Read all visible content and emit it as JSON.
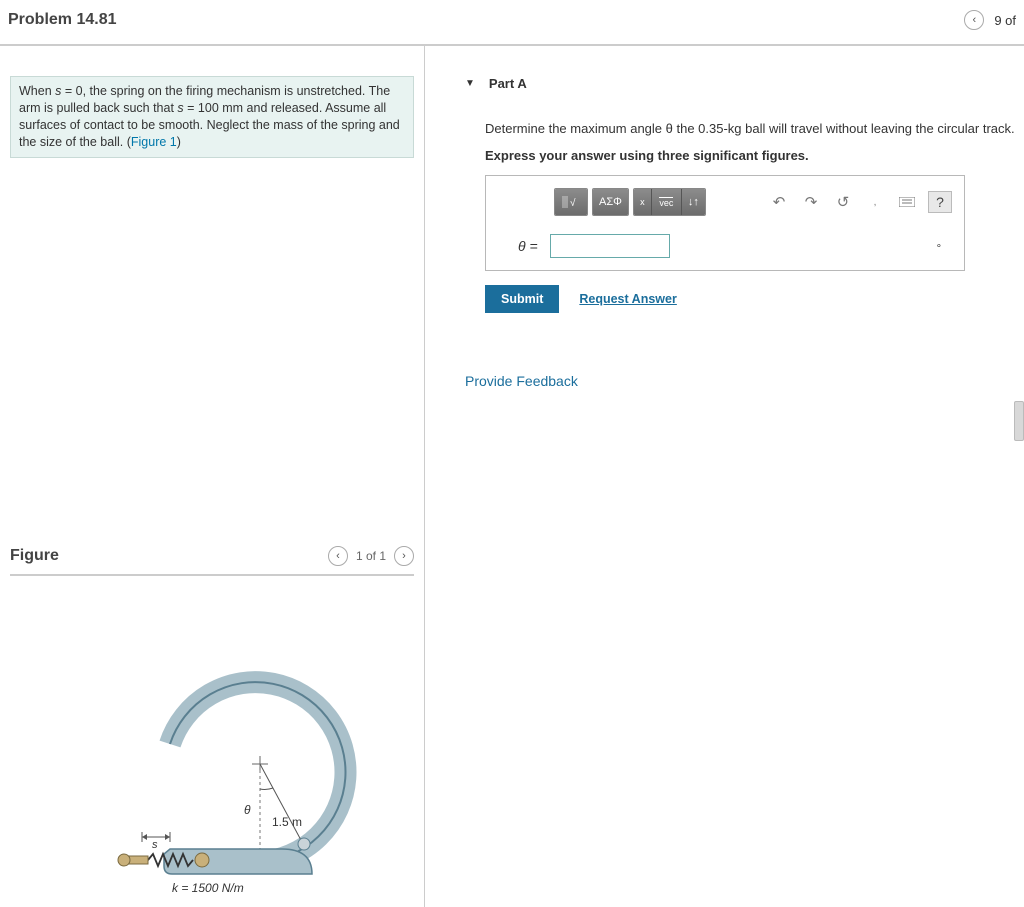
{
  "header": {
    "title": "Problem 14.81",
    "nav_counter": "9 of"
  },
  "problem": {
    "text_prefix": "When ",
    "s_var": "s",
    "eq0": " = 0, the spring on the firing mechanism is unstretched. The arm is pulled back such that ",
    "s_var2": "s",
    "eq100": " = 100 mm and released. Assume all surfaces of contact to be smooth. Neglect the mass of the spring and the size of the ball. (",
    "figure_link": "Figure 1",
    "close_paren": ")"
  },
  "figure": {
    "heading": "Figure",
    "counter": "1 of 1",
    "radius_label": "1.5 m",
    "k_label": "k = 1500 N/m",
    "s_label": "s",
    "theta_label": "θ"
  },
  "partA": {
    "label": "Part A",
    "instruction": "Determine the maximum angle θ the 0.35-kg ball will travel without leaving the circular track.",
    "sigfig": "Express your answer using three significant figures.",
    "toolbar": {
      "templates": "▮√",
      "greek": "ΑΣΦ",
      "sup": "x",
      "vec": "vec",
      "arrow": "↓↑",
      "help": "?"
    },
    "theta_eq": "θ =",
    "unit": "∘",
    "submit": "Submit",
    "request": "Request Answer"
  },
  "feedback": "Provide Feedback"
}
